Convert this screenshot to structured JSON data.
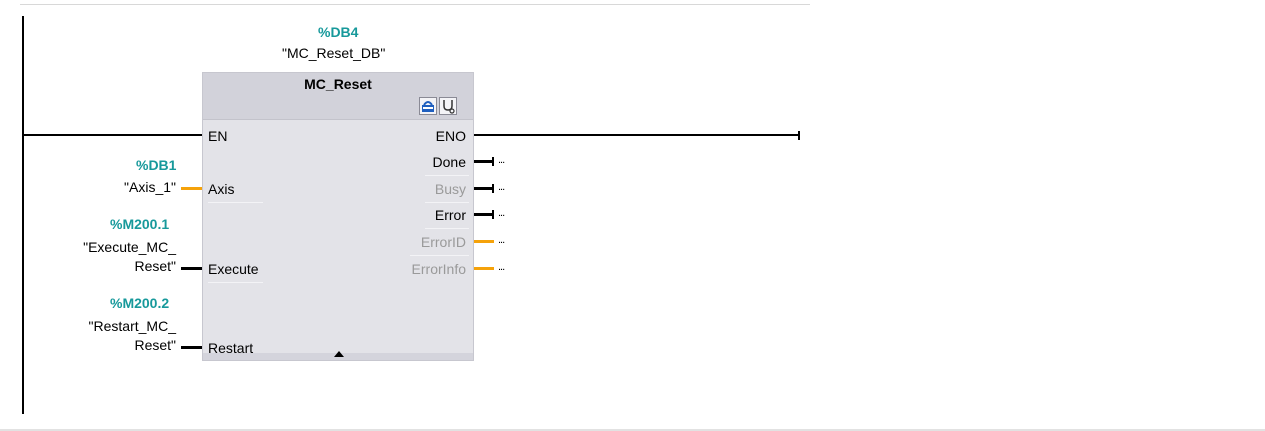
{
  "block": {
    "instance_address": "%DB4",
    "instance_name": "\"MC_Reset_DB\"",
    "type": "MC_Reset",
    "icons": [
      "db-instance-icon",
      "diagnostics-icon"
    ]
  },
  "inputs": [
    {
      "pin": "EN"
    },
    {
      "pin": "Axis",
      "address": "%DB1",
      "operand": "\"Axis_1\"",
      "wire": "orange"
    },
    {
      "pin": "Execute",
      "address": "%M200.1",
      "operand_line1": "\"Execute_MC_",
      "operand_line2": "Reset\"",
      "wire": "black"
    },
    {
      "pin": "Restart",
      "address": "%M200.2",
      "operand_line1": "\"Restart_MC_",
      "operand_line2": "Reset\"",
      "wire": "black"
    }
  ],
  "outputs": [
    {
      "pin": "ENO"
    },
    {
      "pin": "Done",
      "placeholder": "...",
      "wire": "black"
    },
    {
      "pin": "Busy",
      "placeholder": "...",
      "wire": "black"
    },
    {
      "pin": "Error",
      "placeholder": "...",
      "wire": "black"
    },
    {
      "pin": "ErrorID",
      "placeholder": "...",
      "wire": "orange"
    },
    {
      "pin": "ErrorInfo",
      "placeholder": "...",
      "wire": "orange"
    }
  ],
  "colors": {
    "address": "#17999b",
    "wire_struct": "#f5a20a",
    "wire_bool": "#000000",
    "block_body": "#e3e3e8",
    "block_header": "#d2d2da"
  }
}
